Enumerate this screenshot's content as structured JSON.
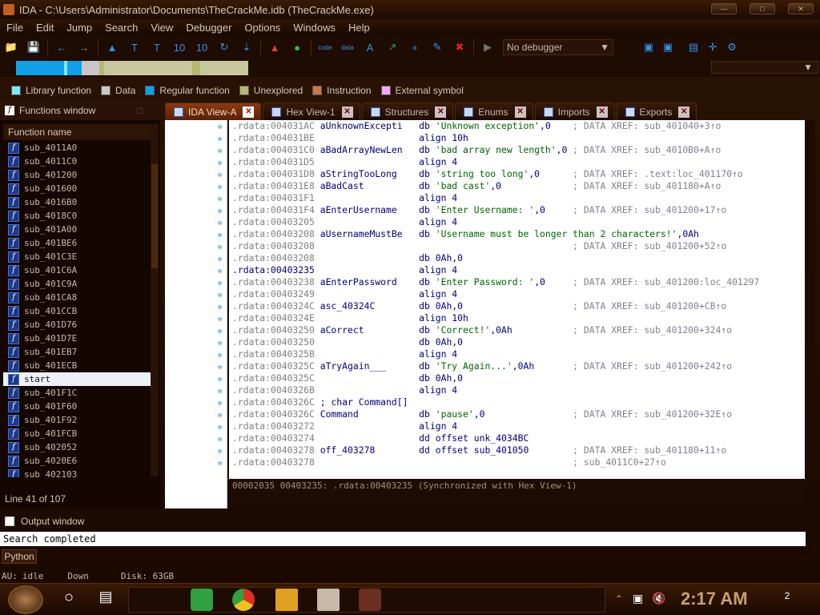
{
  "window": {
    "title": "IDA - C:\\Users\\Administrator\\Documents\\TheCrackMe.idb (TheCrackMe.exe)"
  },
  "menu": [
    "File",
    "Edit",
    "Jump",
    "Search",
    "View",
    "Debugger",
    "Options",
    "Windows",
    "Help"
  ],
  "toolbar": {
    "debugger_select": "No debugger"
  },
  "legend": [
    {
      "label": "Library function",
      "color": "#80e8f0"
    },
    {
      "label": "Data",
      "color": "#c8c8c8"
    },
    {
      "label": "Regular function",
      "color": "#10a0e8"
    },
    {
      "label": "Unexplored",
      "color": "#b8b870"
    },
    {
      "label": "Instruction",
      "color": "#c87850"
    },
    {
      "label": "External symbol",
      "color": "#f8a8f8"
    }
  ],
  "functions_window": {
    "title": "Functions window",
    "column_header": "Function name",
    "items": [
      "sub_4011A0",
      "sub_4011C0",
      "sub_401200",
      "sub_401600",
      "sub_4016B0",
      "sub_4018C0",
      "sub_401A00",
      "sub_401BE6",
      "sub_401C3E",
      "sub_401C6A",
      "sub_401C9A",
      "sub_401CA8",
      "sub_401CCB",
      "sub_401D76",
      "sub_401D7E",
      "sub_401EB7",
      "sub_401ECB",
      "start",
      "sub_401F1C",
      "sub_401F60",
      "sub_401F92",
      "sub_401FCB",
      "sub_402052",
      "sub_4020E6",
      "sub_402103"
    ],
    "selected": "start",
    "line_info": "Line 41 of 107"
  },
  "tabs": [
    {
      "label": "IDA View-A",
      "active": true
    },
    {
      "label": "Hex View-1",
      "active": false
    },
    {
      "label": "Structures",
      "active": false
    },
    {
      "label": "Enums",
      "active": false
    },
    {
      "label": "Imports",
      "active": false
    },
    {
      "label": "Exports",
      "active": false
    }
  ],
  "disasm": [
    {
      "addr": ".rdata:004031AC",
      "name": "aUnknownExcepti",
      "op": "db 'Unknown exception',0",
      "cmt": "; DATA XREF: sub_401040+3↑o"
    },
    {
      "addr": ".rdata:004031BE",
      "name": "",
      "op": "align 10h",
      "cmt": ""
    },
    {
      "addr": ".rdata:004031C0",
      "name": "aBadArrayNewLen",
      "op": "db 'bad array new length',0",
      "cmt": "; DATA XREF: sub_4010B0+A↑o"
    },
    {
      "addr": ".rdata:004031D5",
      "name": "",
      "op": "align 4",
      "cmt": ""
    },
    {
      "addr": ".rdata:004031D8",
      "name": "aStringTooLong",
      "op": "db 'string too long',0",
      "cmt": "; DATA XREF: .text:loc_401170↑o"
    },
    {
      "addr": ".rdata:004031E8",
      "name": "aBadCast",
      "op": "db 'bad cast',0",
      "cmt": "; DATA XREF: sub_401180+A↑o"
    },
    {
      "addr": ".rdata:004031F1",
      "name": "",
      "op": "align 4",
      "cmt": ""
    },
    {
      "addr": ".rdata:004031F4",
      "name": "aEnterUsername",
      "op": "db 'Enter Username: ',0",
      "cmt": "; DATA XREF: sub_401200+17↑o"
    },
    {
      "addr": ".rdata:00403205",
      "name": "",
      "op": "align 4",
      "cmt": ""
    },
    {
      "addr": ".rdata:00403208",
      "name": "aUsernameMustBe",
      "op": "db 'Username must be longer than 2 characters!',0Ah",
      "cmt": ""
    },
    {
      "addr": ".rdata:00403208",
      "name": "",
      "op": "",
      "cmt": "; DATA XREF: sub_401200+52↑o"
    },
    {
      "addr": ".rdata:00403208",
      "name": "",
      "op": "db 0Ah,0",
      "cmt": ""
    },
    {
      "addr": ".rdata:00403235",
      "name": "",
      "op": "align 4",
      "cmt": "",
      "current": true
    },
    {
      "addr": ".rdata:00403238",
      "name": "aEnterPassword",
      "op": "db 'Enter Password: ',0",
      "cmt": "; DATA XREF: sub_401200:loc_401297"
    },
    {
      "addr": ".rdata:00403249",
      "name": "",
      "op": "align 4",
      "cmt": ""
    },
    {
      "addr": ".rdata:0040324C",
      "name": "asc_40324C",
      "op": "db 0Ah,0",
      "cmt": "; DATA XREF: sub_401200+CB↑o"
    },
    {
      "addr": ".rdata:0040324E",
      "name": "",
      "op": "align 10h",
      "cmt": ""
    },
    {
      "addr": ".rdata:00403250",
      "name": "aCorrect",
      "op": "db 'Correct!',0Ah",
      "cmt": "; DATA XREF: sub_401200+324↑o"
    },
    {
      "addr": ".rdata:00403250",
      "name": "",
      "op": "db 0Ah,0",
      "cmt": ""
    },
    {
      "addr": ".rdata:0040325B",
      "name": "",
      "op": "align 4",
      "cmt": ""
    },
    {
      "addr": ".rdata:0040325C",
      "name": "aTryAgain___",
      "op": "db 'Try Again...',0Ah",
      "cmt": "; DATA XREF: sub_401200+242↑o"
    },
    {
      "addr": ".rdata:0040325C",
      "name": "",
      "op": "db 0Ah,0",
      "cmt": ""
    },
    {
      "addr": ".rdata:0040326B",
      "name": "",
      "op": "align 4",
      "cmt": ""
    },
    {
      "addr": ".rdata:0040326C",
      "name": "; char Command[]",
      "op": "",
      "cmt": ""
    },
    {
      "addr": ".rdata:0040326C",
      "name": "Command",
      "op": "db 'pause',0",
      "cmt": "; DATA XREF: sub_401200+32E↑o"
    },
    {
      "addr": ".rdata:00403272",
      "name": "",
      "op": "align 4",
      "cmt": ""
    },
    {
      "addr": ".rdata:00403274",
      "name": "",
      "op": "dd offset unk_4034BC",
      "cmt": ""
    },
    {
      "addr": ".rdata:00403278",
      "name": "off_403278",
      "op": "dd offset sub_401050",
      "cmt": "; DATA XREF: sub_401180+11↑o"
    },
    {
      "addr": ".rdata:00403278",
      "name": "",
      "op": "",
      "cmt": "; sub_4011C0+27↑o"
    }
  ],
  "sync_status": "00002035 00403235: .rdata:00403235 (Synchronized with Hex View-1)",
  "output_window": {
    "title": "Output window",
    "text": "Search completed"
  },
  "python_button": "Python",
  "status": {
    "au": "AU:",
    "state": "idle",
    "direction": "Down",
    "disk": "Disk: 63GB"
  },
  "taskbar": {
    "clock": "2:17 AM",
    "notifications": "2"
  }
}
